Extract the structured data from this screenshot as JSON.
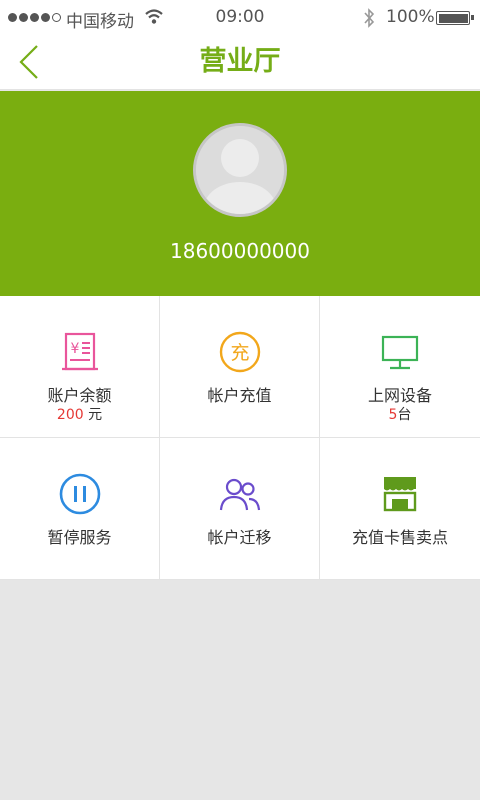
{
  "status_bar": {
    "carrier": "中国移动",
    "time": "09:00",
    "battery": "100%",
    "icons": [
      "signal-dots-icon",
      "wifi-icon",
      "bluetooth-icon",
      "battery-icon"
    ]
  },
  "nav": {
    "title": "营业厅",
    "back_icon": "chevron-left-icon"
  },
  "profile": {
    "phone": "18600000000",
    "avatar_icon": "default-avatar-icon"
  },
  "menu": {
    "account_balance": {
      "label": "账户余额",
      "value": "200",
      "unit": " 元",
      "icon": "receipt-yen-icon"
    },
    "account_recharge": {
      "label": "帐户充值",
      "icon": "recharge-badge-icon"
    },
    "online_devices": {
      "label": "上网设备",
      "value": "5",
      "unit": "台",
      "icon": "monitor-icon"
    },
    "pause_service": {
      "label": "暂停服务",
      "icon": "pause-circle-icon"
    },
    "account_transfer": {
      "label": "帐户迁移",
      "icon": "users-icon"
    },
    "card_outlets": {
      "label": "充值卡售卖点",
      "icon": "store-icon"
    }
  },
  "colors": {
    "brand_green": "#7aae10",
    "title_green": "#75ad17",
    "highlight_red": "#e53935",
    "balance_pink": "#e9559b",
    "recharge_orange": "#f2a71b",
    "device_green": "#3cb356",
    "pause_blue": "#2d8be0",
    "transfer_purple": "#6a4ccc",
    "store_green": "#5f9a1c"
  }
}
